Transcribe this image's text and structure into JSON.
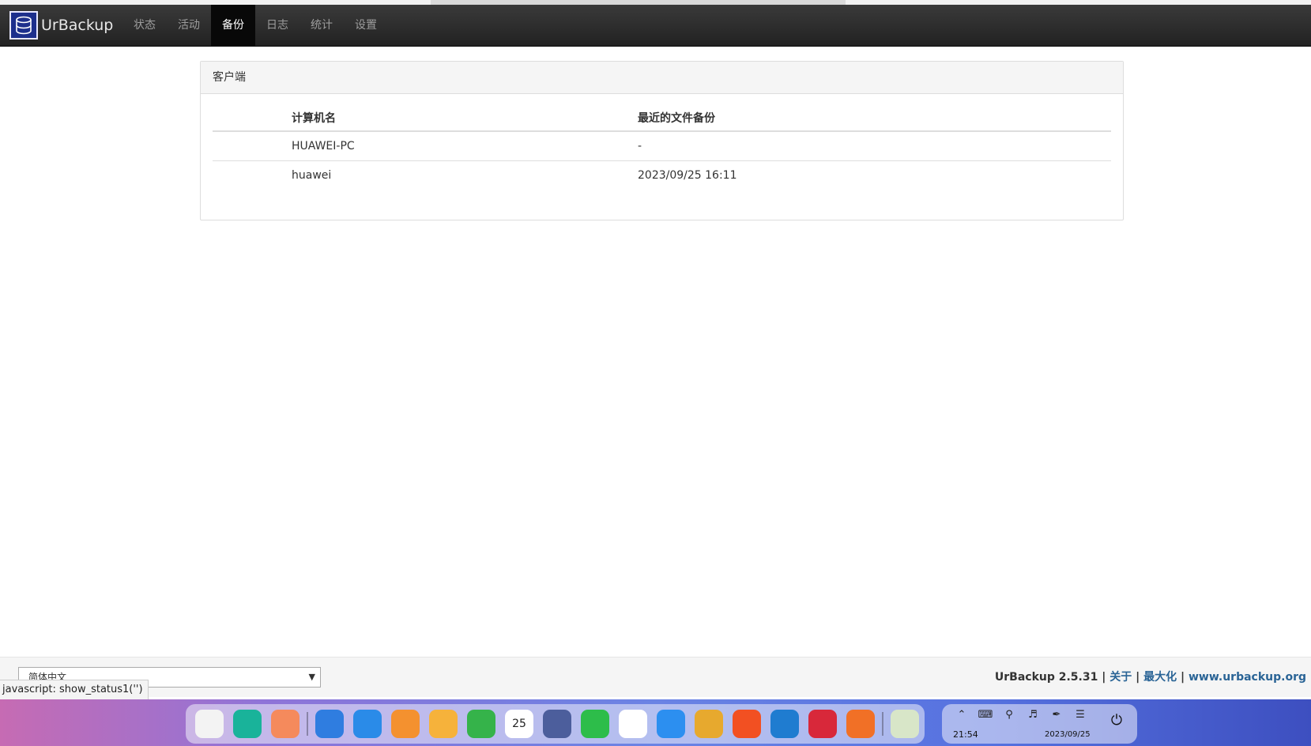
{
  "brand": {
    "name": "UrBackup"
  },
  "nav": {
    "items": [
      {
        "label": "状态"
      },
      {
        "label": "活动"
      },
      {
        "label": "备份"
      },
      {
        "label": "日志"
      },
      {
        "label": "统计"
      },
      {
        "label": "设置"
      }
    ],
    "active": "备份"
  },
  "panel": {
    "title": "客户端",
    "columns": [
      "计算机名",
      "最近的文件备份"
    ],
    "rows": [
      {
        "name": "HUAWEI-PC",
        "last_file_backup": "-"
      },
      {
        "name": "huawei",
        "last_file_backup": "2023/09/25 16:11"
      }
    ]
  },
  "footer": {
    "language_selected": "简体中文",
    "version": "UrBackup 2.5.31",
    "sep": "|",
    "about_label": "关于",
    "maximize_label": "最大化",
    "website_label": "www.urbackup.org"
  },
  "status_bar": {
    "text": "javascript: show_status1('')"
  },
  "taskbar": {
    "apps": [
      {
        "name": "launcher-icon",
        "color": "#f3f3f3"
      },
      {
        "name": "terminal-app-icon",
        "color": "#19b39a"
      },
      {
        "name": "app-store-icon",
        "color": "#f58a5c"
      },
      {
        "name": "file-manager-icon",
        "color": "#2f7de0"
      },
      {
        "name": "browser-icon",
        "color": "#2a8be8"
      },
      {
        "name": "shop-icon",
        "color": "#f4912f"
      },
      {
        "name": "image-viewer-icon",
        "color": "#f6b23b"
      },
      {
        "name": "music-icon",
        "color": "#35b34a"
      },
      {
        "name": "calendar-icon",
        "color": "#ffffff",
        "text": "25"
      },
      {
        "name": "settings-icon",
        "color": "#4c5e9c"
      },
      {
        "name": "wechat-icon",
        "color": "#2dbd4a"
      },
      {
        "name": "qq-icon",
        "color": "#ffffff"
      },
      {
        "name": "messenger-icon",
        "color": "#2c8ff0"
      },
      {
        "name": "virtualbox-icon",
        "color": "#e7a92e"
      },
      {
        "name": "media-player-icon",
        "color": "#f25022"
      },
      {
        "name": "vscode-icon",
        "color": "#1f7cd0"
      },
      {
        "name": "remote-terminal-icon",
        "color": "#d8283a"
      },
      {
        "name": "firefox-icon",
        "color": "#f17026"
      },
      {
        "name": "trash-icon",
        "color": "#d8e6c8"
      }
    ],
    "time": "21:54",
    "date": "2023/09/25"
  }
}
